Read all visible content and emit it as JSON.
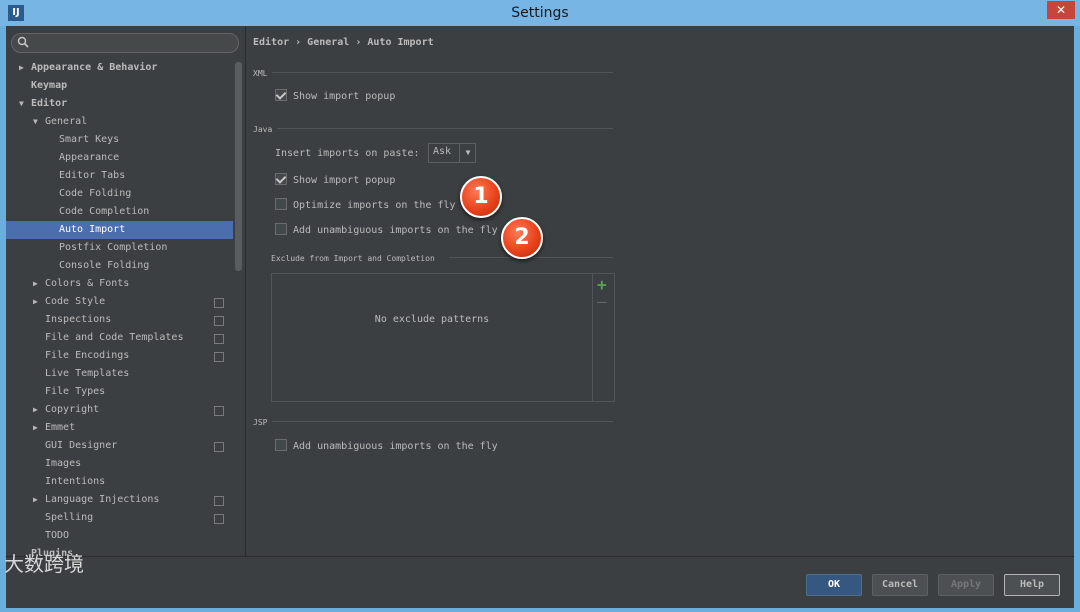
{
  "window": {
    "title": "Settings",
    "close": "✕",
    "app_icon_label": "IJ"
  },
  "search": {
    "placeholder": ""
  },
  "tree": [
    {
      "label": "Appearance & Behavior",
      "level": 0,
      "arrow": "▶",
      "bold": true
    },
    {
      "label": "Keymap",
      "level": 0,
      "arrow": "",
      "bold": true
    },
    {
      "label": "Editor",
      "level": 0,
      "arrow": "▼",
      "bold": true
    },
    {
      "label": "General",
      "level": 1,
      "arrow": "▼"
    },
    {
      "label": "Smart Keys",
      "level": 2,
      "arrow": ""
    },
    {
      "label": "Appearance",
      "level": 2,
      "arrow": ""
    },
    {
      "label": "Editor Tabs",
      "level": 2,
      "arrow": ""
    },
    {
      "label": "Code Folding",
      "level": 2,
      "arrow": ""
    },
    {
      "label": "Code Completion",
      "level": 2,
      "arrow": ""
    },
    {
      "label": "Auto Import",
      "level": 2,
      "arrow": "",
      "selected": true
    },
    {
      "label": "Postfix Completion",
      "level": 2,
      "arrow": ""
    },
    {
      "label": "Console Folding",
      "level": 2,
      "arrow": ""
    },
    {
      "label": "Colors & Fonts",
      "level": 1,
      "arrow": "▶"
    },
    {
      "label": "Code Style",
      "level": 1,
      "arrow": "▶",
      "project": true
    },
    {
      "label": "Inspections",
      "level": 1,
      "arrow": "",
      "project": true
    },
    {
      "label": "File and Code Templates",
      "level": 1,
      "arrow": "",
      "project": true
    },
    {
      "label": "File Encodings",
      "level": 1,
      "arrow": "",
      "project": true
    },
    {
      "label": "Live Templates",
      "level": 1,
      "arrow": ""
    },
    {
      "label": "File Types",
      "level": 1,
      "arrow": ""
    },
    {
      "label": "Copyright",
      "level": 1,
      "arrow": "▶",
      "project": true
    },
    {
      "label": "Emmet",
      "level": 1,
      "arrow": "▶"
    },
    {
      "label": "GUI Designer",
      "level": 1,
      "arrow": "",
      "project": true
    },
    {
      "label": "Images",
      "level": 1,
      "arrow": ""
    },
    {
      "label": "Intentions",
      "level": 1,
      "arrow": ""
    },
    {
      "label": "Language Injections",
      "level": 1,
      "arrow": "▶",
      "project": true
    },
    {
      "label": "Spelling",
      "level": 1,
      "arrow": "",
      "project": true
    },
    {
      "label": "TODO",
      "level": 1,
      "arrow": ""
    },
    {
      "label": "Plugins",
      "level": 0,
      "arrow": "",
      "bold": true
    }
  ],
  "breadcrumb": "Editor › General › Auto Import",
  "xml": {
    "section": "XML",
    "show_popup": {
      "label": "Show import popup",
      "checked": true
    }
  },
  "java": {
    "section": "Java",
    "insert_label": "Insert imports on paste:",
    "insert_value": "Ask",
    "combo_arrow": "▼",
    "show_popup": {
      "label": "Show import popup",
      "checked": true
    },
    "optimize": {
      "label": "Optimize imports on the fly",
      "checked": false
    },
    "unambiguous": {
      "label": "Add unambiguous imports on the fly",
      "checked": false
    },
    "exclude_title": "Exclude from Import and Completion",
    "exclude_empty": "No exclude patterns",
    "add": "+",
    "remove": "—"
  },
  "jsp": {
    "section": "JSP",
    "unambiguous": {
      "label": "Add unambiguous imports on the fly",
      "checked": false
    }
  },
  "badges": [
    "1",
    "2"
  ],
  "buttons": {
    "ok": "OK",
    "cancel": "Cancel",
    "apply": "Apply",
    "help": "Help"
  },
  "watermark": "大数跨境"
}
